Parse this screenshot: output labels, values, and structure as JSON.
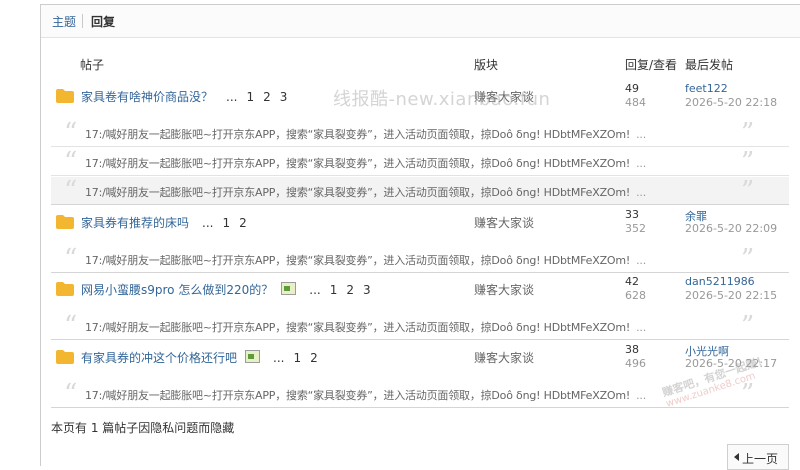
{
  "tabs": {
    "topic": "主题",
    "reply": "回复"
  },
  "headers": {
    "post": "帖子",
    "forum": "版块",
    "stats": "回复/查看",
    "last": "最后发帖"
  },
  "threads": [
    {
      "title": "家具卷有啥神价商品没？",
      "pages": [
        "...",
        "1",
        "2",
        "3"
      ],
      "has_image": false,
      "forum": "赚客大家谈",
      "replies": "49",
      "views": "484",
      "last_user": "feet122",
      "last_time": "2026-5-20 22:18",
      "posts": [
        {
          "text": "17:/喊好朋友一起膨胀吧~打开京东APP，搜索“家具裂变券”，进入活动页面领取，掠Doô δng! HDbtMFeXZOm!",
          "more": "...",
          "gray": false
        },
        {
          "text": "17:/喊好朋友一起膨胀吧~打开京东APP，搜索“家具裂变券”，进入活动页面领取，掠Doô δng! HDbtMFeXZOm!",
          "more": "...",
          "gray": false
        },
        {
          "text": "17:/喊好朋友一起膨胀吧~打开京东APP，搜索“家具裂变券”，进入活动页面领取，掠Doô δng! HDbtMFeXZOm!",
          "more": "...",
          "gray": true
        }
      ]
    },
    {
      "title": "家具券有推荐的床吗",
      "pages": [
        "...",
        "1",
        "2"
      ],
      "has_image": false,
      "forum": "赚客大家谈",
      "replies": "33",
      "views": "352",
      "last_user": "余罪",
      "last_time": "2026-5-20 22:09",
      "posts": [
        {
          "text": "17:/喊好朋友一起膨胀吧~打开京东APP，搜索“家具裂变券”，进入活动页面领取，掠Doô δng! HDbtMFeXZOm!",
          "more": "...",
          "gray": false
        }
      ]
    },
    {
      "title": "网易小蛮腰s9pro 怎么做到220的？",
      "pages": [
        "...",
        "1",
        "2",
        "3"
      ],
      "has_image": true,
      "forum": "赚客大家谈",
      "replies": "42",
      "views": "628",
      "last_user": "dan5211986",
      "last_time": "2026-5-20 22:15",
      "posts": [
        {
          "text": "17:/喊好朋友一起膨胀吧~打开京东APP，搜索“家具裂变券”，进入活动页面领取，掠Doô δng! HDbtMFeXZOm!",
          "more": "...",
          "gray": false
        }
      ]
    },
    {
      "title": "有家具券的冲这个价格还行吧",
      "pages": [
        "...",
        "1",
        "2"
      ],
      "has_image": true,
      "forum": "赚客大家谈",
      "replies": "38",
      "views": "496",
      "last_user": "小光光啊",
      "last_time": "2026-5-20 22:17",
      "posts": [
        {
          "text": "17:/喊好朋友一起膨胀吧~打开京东APP，搜索“家具裂变券”，进入活动页面领取，掠Doô δng! HDbtMFeXZOm!",
          "more": "...",
          "gray": false
        }
      ]
    }
  ],
  "footer": {
    "hidden_note": "本页有 1 篇帖子因隐私问题而隐藏",
    "prev_label": "上一页"
  },
  "watermarks": {
    "center": "线报酷-new.xianbao.fun",
    "corner_1": "赚客吧，有您一起赚！",
    "corner_2": "www.zuanke8.com"
  },
  "icons": {
    "folder": "folder-icon",
    "image": "image-attachment-icon",
    "quote": "quote-icon",
    "prev": "triangle-left-icon"
  },
  "colors": {
    "link": "#336699",
    "folder": "#f2b630",
    "muted": "#999999"
  }
}
